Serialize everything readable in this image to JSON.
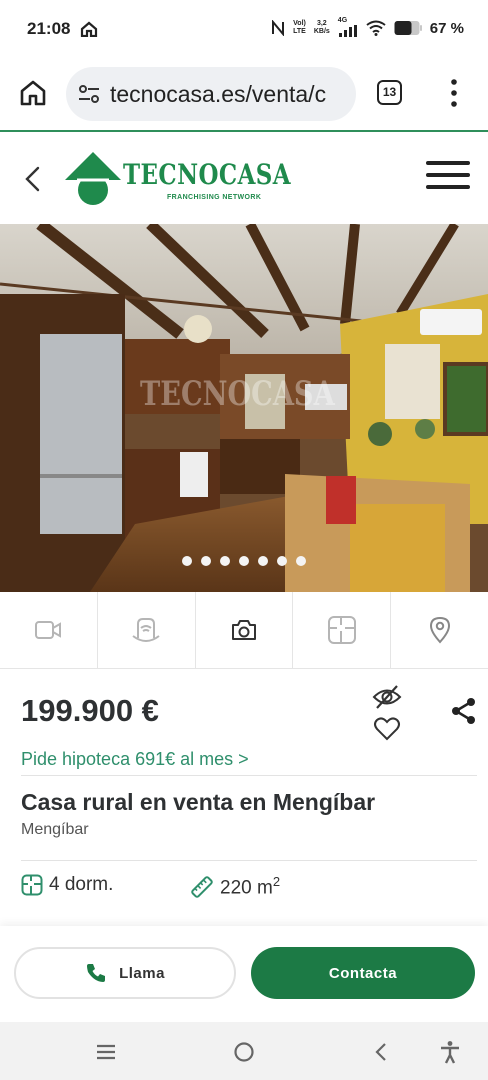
{
  "status_bar": {
    "time": "21:08",
    "network_top": "Vol)",
    "network_bottom": "LTE",
    "speed_top": "3,2",
    "speed_bottom": "KB/s",
    "signal_label": "4G",
    "battery": "67 %"
  },
  "browser": {
    "url": "tecnocasa.es/venta/c",
    "tab_count": "13"
  },
  "header": {
    "logo_text": "TECNOCASA",
    "logo_sub": "FRANCHISING NETWORK"
  },
  "gallery": {
    "watermark": "TECNOCASA",
    "dots": 7
  },
  "listing": {
    "price": "199.900 €",
    "mortgage": "Pide hipoteca 691€ al mes >",
    "title": "Casa rural en venta en Mengíbar",
    "location": "Mengíbar",
    "rooms": "4 dorm.",
    "area": "220 m",
    "area_unit_exp": "2"
  },
  "cta": {
    "call_label": "Llama",
    "contact_label": "Contacta"
  },
  "colors": {
    "brand_green": "#1c7a45",
    "link_green": "#2f8f6c",
    "text_dark": "#2e3133"
  }
}
